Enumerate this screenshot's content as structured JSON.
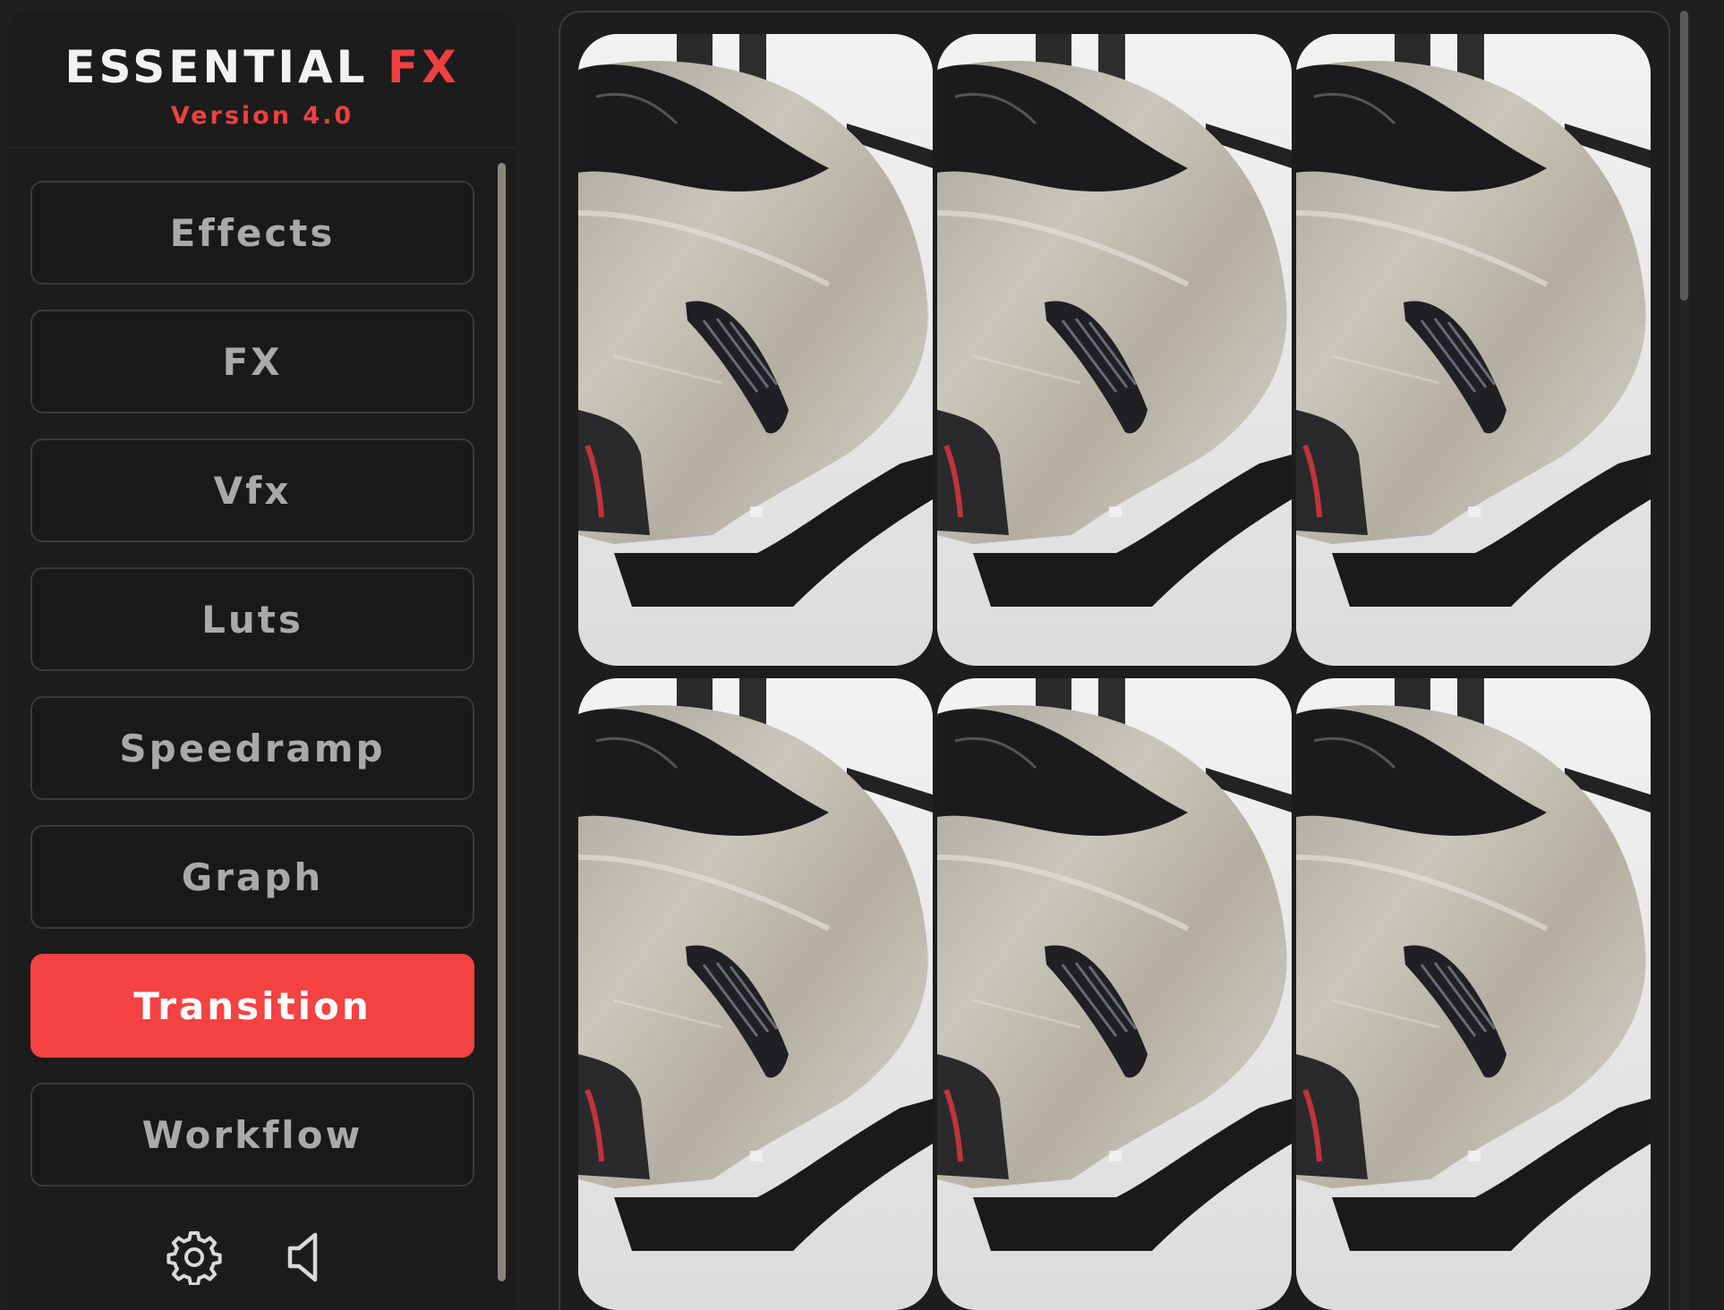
{
  "app": {
    "title_part1": "ESSENTIAL",
    "title_part2": "FX",
    "version": "Version 4.0"
  },
  "colors": {
    "accent": "#f54242",
    "background": "#1f1f1f",
    "button_text": "#a9a9a9"
  },
  "nav": {
    "items": [
      {
        "label": "Effects",
        "active": false
      },
      {
        "label": "FX",
        "active": false
      },
      {
        "label": "Vfx",
        "active": false
      },
      {
        "label": "Luts",
        "active": false
      },
      {
        "label": "Speedramp",
        "active": false
      },
      {
        "label": "Graph",
        "active": false
      },
      {
        "label": "Transition",
        "active": true
      },
      {
        "label": "Workflow",
        "active": false
      }
    ]
  },
  "footer_icons": [
    "gear-icon",
    "speaker-icon"
  ],
  "gallery": {
    "items": [
      {
        "subject": "car-front-closeup"
      },
      {
        "subject": "car-front-closeup"
      },
      {
        "subject": "car-front-closeup"
      },
      {
        "subject": "car-front-closeup"
      },
      {
        "subject": "car-front-closeup"
      },
      {
        "subject": "car-front-closeup"
      }
    ]
  }
}
